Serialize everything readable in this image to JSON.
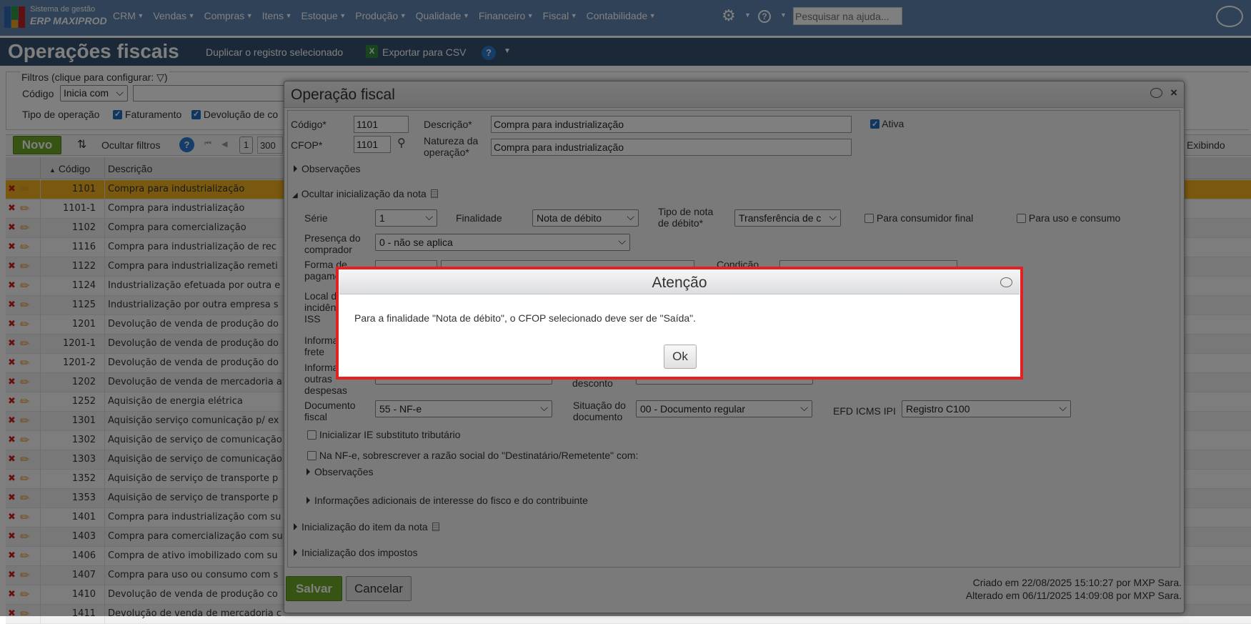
{
  "nav": {
    "brand_line1": "Sistema de gestão",
    "brand_line2": "ERP MAXIPROD",
    "menu": [
      "CRM",
      "Vendas",
      "Compras",
      "Itens",
      "Estoque",
      "Produção",
      "Qualidade",
      "Financeiro",
      "Fiscal",
      "Contabilidade"
    ],
    "help_search_placeholder": "Pesquisar na ajuda...",
    "icons": [
      "gear-icon",
      "help-icon",
      "chat-icon"
    ]
  },
  "page": {
    "title": "Operações fiscais",
    "duplicate_label": "Duplicar o registro selecionado",
    "export_label": "Exportar para CSV"
  },
  "filters": {
    "legend": "Filtros (clique para configurar:",
    "legend_close": ")",
    "codigo_label": "Código",
    "codigo_operator": "Inicia com",
    "tipo_label": "Tipo de operação",
    "tipo_options": [
      "Faturamento",
      "Devolução de co"
    ]
  },
  "toolbar": {
    "new_label": "Novo",
    "hide_filters_label": "Ocultar filtros",
    "page": "1",
    "page_size": "300",
    "showing_label": "Exibindo"
  },
  "grid": {
    "columns": [
      "Código",
      "Descrição"
    ],
    "sort": "Código ascending",
    "selected_index": 0,
    "rows": [
      [
        "1101",
        "Compra para industrialização"
      ],
      [
        "1101-1",
        "Compra para industrialização"
      ],
      [
        "1102",
        "Compra para comercialização"
      ],
      [
        "1116",
        "Compra para industrialização de rec"
      ],
      [
        "1122",
        "Compra para industrialização remeti"
      ],
      [
        "1124",
        "Industrialização efetuada por outra e"
      ],
      [
        "1125",
        "Industrialização por outra empresa s"
      ],
      [
        "1201",
        "Devolução de venda de produção do"
      ],
      [
        "1201-1",
        "Devolução de venda de produção do"
      ],
      [
        "1201-2",
        "Devolução de venda de produção do"
      ],
      [
        "1202",
        "Devolução de venda de mercadoria a"
      ],
      [
        "1252",
        "Aquisição de energia elétrica"
      ],
      [
        "1301",
        "Aquisição serviço comunicação p/ ex"
      ],
      [
        "1302",
        "Aquisição de serviço de comunicação"
      ],
      [
        "1303",
        "Aquisição de serviço de comunicação"
      ],
      [
        "1352",
        "Aquisição de serviço de transporte p"
      ],
      [
        "1353",
        "Aquisição de serviço de transporte p"
      ],
      [
        "1401",
        "Compra para industrialização com su"
      ],
      [
        "1403",
        "Compra para comercialização com su"
      ],
      [
        "1406",
        "Compra de ativo imobilizado com su"
      ],
      [
        "1407",
        "Compra para uso ou consumo com s"
      ],
      [
        "1410",
        "Devolução de venda de produção co"
      ],
      [
        "1411",
        "Devolução de venda de mercadoria c"
      ]
    ]
  },
  "dialog": {
    "title": "Operação fiscal",
    "codigo_label": "Código*",
    "codigo_value": "1101",
    "descricao_label": "Descrição*",
    "descricao_value": "Compra para industrialização",
    "ativa_label": "Ativa",
    "cfop_label": "CFOP*",
    "cfop_value": "1101",
    "natureza_label_1": "Natureza da",
    "natureza_label_2": "operação*",
    "natureza_value": "Compra para industrialização",
    "observacoes": "Observações",
    "ocultar_inicializacao": "Ocultar inicialização da nota",
    "serie_label": "Série",
    "serie_value": "1",
    "finalidade_label": "Finalidade",
    "finalidade_value": "Nota de débito",
    "tipo_nota_label_1": "Tipo de nota",
    "tipo_nota_label_2": "de débito*",
    "tipo_nota_value": "Transferência de c",
    "consumidor_final_label": "Para consumidor final",
    "uso_consumo_label": "Para uso e consumo",
    "presenca_label_1": "Presença do",
    "presenca_label_2": "comprador",
    "presenca_value": "0 - não se aplica",
    "forma_label_1": "Forma de",
    "forma_label_2": "pagamento",
    "condicao_label": "Condição",
    "local_label_1": "Local de",
    "local_label_2": "incidência",
    "local_label_3": "ISS",
    "frete_label_1": "Informações",
    "frete_label_2": "frete",
    "outras_label_1": "Informações",
    "outras_label_2": "outras",
    "outras_label_3": "despesas",
    "desconto_label": "desconto",
    "documento_label_1": "Documento",
    "documento_label_2": "fiscal",
    "documento_value": "55 - NF-e",
    "situacao_label_1": "Situação do",
    "situacao_label_2": "documento",
    "situacao_value": "00 - Documento regular",
    "efd_label": "EFD ICMS IPI",
    "efd_value": "Registro C100",
    "ie_st_label": "Inicializar IE substituto tributário",
    "sobrescrever_label": "Na NF-e, sobrescrever a razão social do \"Destinatário/Remetente\" com:",
    "observacoes_2": "Observações",
    "info_adicionais": "Informações adicionais de interesse do fisco e do contribuinte",
    "inicializacao_item": "Inicialização do item da nota",
    "inicializacao_impostos": "Inicialização dos impostos",
    "save_label": "Salvar",
    "cancel_label": "Cancelar",
    "created": "Criado em 22/08/2025 15:10:27 por MXP Sara.",
    "modified": "Alterado em 06/11/2025 14:09:08 por MXP Sara."
  },
  "alert": {
    "title": "Atenção",
    "message": "Para a finalidade \"Nota de débito\", o CFOP selecionado deve ser de \"Saída\".",
    "ok_label": "Ok",
    "highlight_color": "#e52020"
  }
}
